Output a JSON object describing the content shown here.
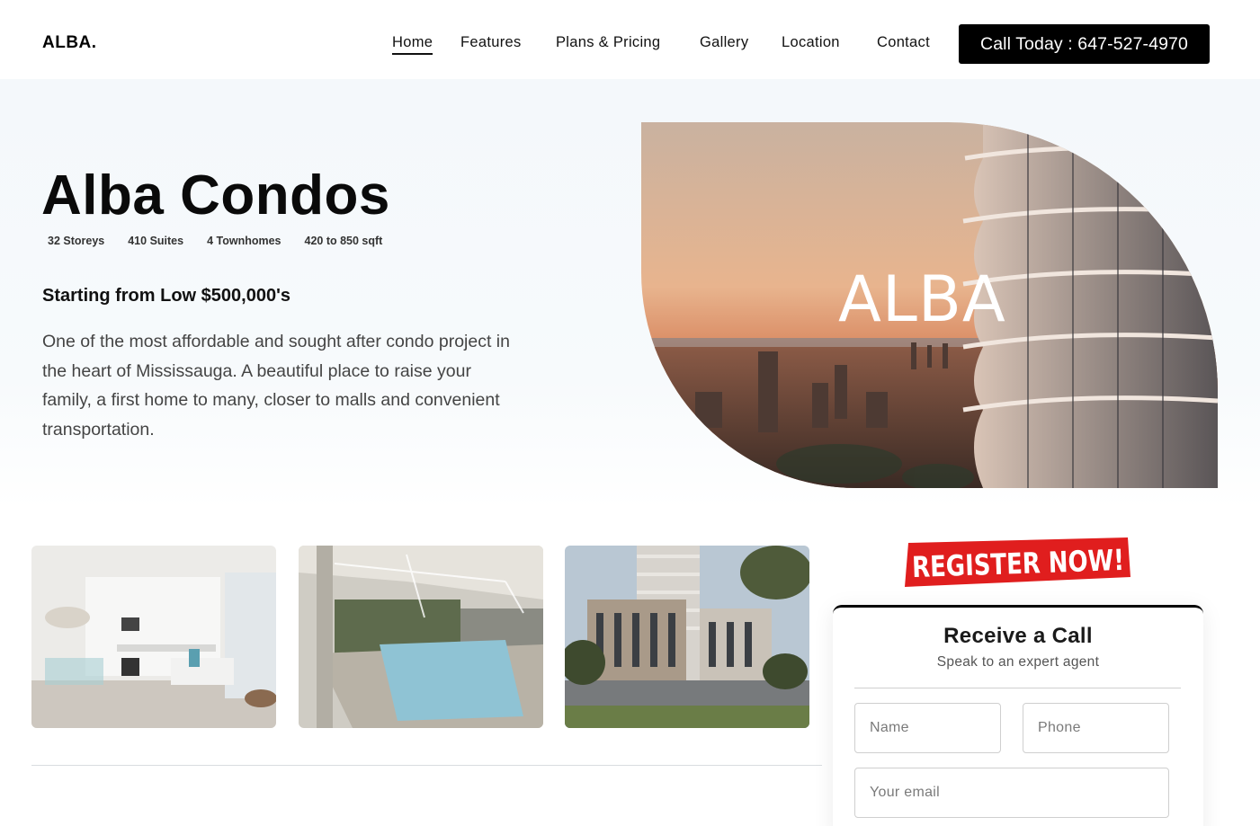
{
  "header": {
    "logo": "ALBA.",
    "nav": [
      {
        "label": "Home",
        "active": true
      },
      {
        "label": "Features"
      },
      {
        "label": "Plans & Pricing"
      },
      {
        "label": "Gallery"
      },
      {
        "label": "Location"
      },
      {
        "label": "Contact"
      }
    ],
    "call_label": "Call Today : 647-527-4970"
  },
  "hero": {
    "title_part1": "Alba",
    "title_part2": "Condos",
    "stats": [
      "32 Storeys",
      "410 Suites",
      "4 Townhomes",
      "420 to 850 sqft"
    ],
    "price": "Starting from Low $500,000's",
    "description": "One of the most affordable and sought after condo project in the heart of Mississauga. A beautiful place to raise your family, a first home to many, closer to malls and convenient transportation.",
    "image_overlay": "ALBA"
  },
  "gallery": [
    {
      "icon": "kitchen-interior-image"
    },
    {
      "icon": "indoor-pool-image"
    },
    {
      "icon": "building-exterior-image"
    }
  ],
  "register": {
    "badge": "REGISTER NOW!",
    "title": "Receive a Call",
    "subtitle": "Speak to an expert agent",
    "name_placeholder": "Name",
    "phone_placeholder": "Phone",
    "email_placeholder": "Your email"
  },
  "colors": {
    "accent_black": "#000000",
    "highlight": "#eafdb0",
    "badge_red": "#e01e1e",
    "hero_bg": "#f4f8fb"
  }
}
